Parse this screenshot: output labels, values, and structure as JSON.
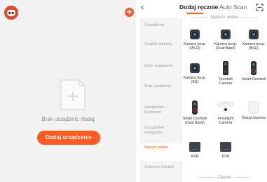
{
  "left": {
    "empty_text": "Brak urządzeń, dodaj",
    "add_button": "Dodaj urządzenie"
  },
  "header": {
    "back": "‹",
    "tab_manual": "Dodaj ręcznie",
    "tab_auto": "Auto Scan"
  },
  "sidebar": [
    "Oświetlenie",
    "Czujnik ochrony",
    "Duże urządzeni...",
    "Małe urządzeni...",
    "Urządzenie kuchenne",
    "Urządzenie medyczne...",
    "Nadzór wideo",
    "Gateway Control"
  ],
  "section_title": "Nadzór wideo",
  "next_section": "Zamek",
  "devices": [
    {
      "label": "Kamera bezp. (Wi-Fi)",
      "icon": "camera-wifi"
    },
    {
      "label": "Kamera bezp. (Dual Band)",
      "icon": "camera-dual-band"
    },
    {
      "label": "Kamera bezp. (BLE)",
      "icon": "camera-ble"
    },
    {
      "label": "Kamera bezp. (4G)",
      "icon": "camera-4g"
    },
    {
      "label": "Doorbell Camera",
      "icon": "doorbell-camera"
    },
    {
      "label": "Smart Doorbell",
      "icon": "smart-doorbell"
    },
    {
      "label": "Smart Doorbell (Dual Band)",
      "icon": "smart-doorbell-dual"
    },
    {
      "label": "Floodlight Camera",
      "icon": "floodlight-camera"
    },
    {
      "label": "Stacja bazowa",
      "icon": "base-station"
    },
    {
      "label": "NVR",
      "icon": "nvr"
    },
    {
      "label": "DVR",
      "icon": "dvr"
    }
  ],
  "colors": {
    "accent": "#ff5a1f",
    "avatar": "#e04a2a",
    "left_bg": "#f2f2f2"
  }
}
